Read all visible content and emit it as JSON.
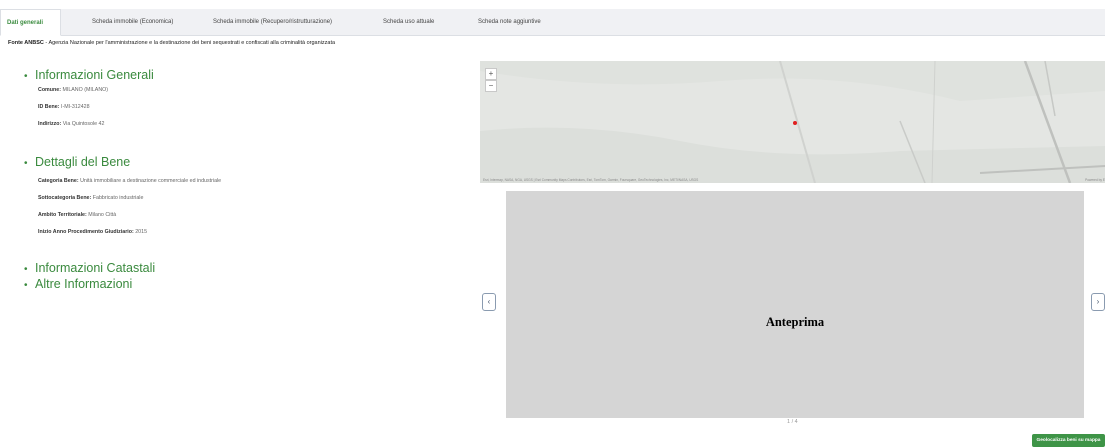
{
  "tabs": [
    {
      "label": "Dati generali",
      "active": true
    },
    {
      "label": "Scheda immobile (Economica)",
      "active": false
    },
    {
      "label": "Scheda immobile (Recupero/ristrutturazione)",
      "active": false
    },
    {
      "label": "Scheda uso attuale",
      "active": false
    },
    {
      "label": "Scheda note aggiuntive",
      "active": false
    }
  ],
  "source": {
    "bold": "Fonte ANBSC",
    "text": " - Agenzia Nazionale per l'amministrazione e la destinazione dei beni sequestrati e confiscati alla criminalità organizzata"
  },
  "sections": {
    "generali": {
      "title": "Informazioni Generali",
      "fields": [
        {
          "label": "Comune:",
          "value": "MILANO (MILANO)"
        },
        {
          "label": "ID Bene:",
          "value": "I-MI-312428"
        },
        {
          "label": "Indirizzo:",
          "value": "Via Quintosole 42"
        }
      ]
    },
    "dettagli": {
      "title": "Dettagli del Bene",
      "fields": [
        {
          "label": "Categoria Bene:",
          "value": "Unità immobiliare a destinazione commerciale ed industriale"
        },
        {
          "label": "Sottocategoria Bene:",
          "value": "Fabbricato industriale"
        },
        {
          "label": "Ambito Territoriale:",
          "value": "Milano Città"
        },
        {
          "label": "Inizio Anno Procedimento Giudiziario:",
          "value": "2015"
        }
      ]
    },
    "catastali": {
      "title": "Informazioni Catastali"
    },
    "altre": {
      "title": "Altre Informazioni"
    }
  },
  "map": {
    "zoom_in": "+",
    "zoom_out": "−",
    "attribution": "Esri, Intermap, NASA, NGA, USGS | Esri Community Maps Contributors, Esri, TomTom, Garmin, Foursquare, GeoTechnologies, Inc, METI/NASA, USGS",
    "powered_by": "Powered by E",
    "marker_color": "#e02020"
  },
  "preview": {
    "label": "Anteprima",
    "prev_icon": "‹",
    "next_icon": "›",
    "counter": "1 / 4"
  },
  "geolocate_button": "Geolocalizza beni su mappa",
  "colors": {
    "accent": "#3a8a3e",
    "button": "#3e9447"
  }
}
